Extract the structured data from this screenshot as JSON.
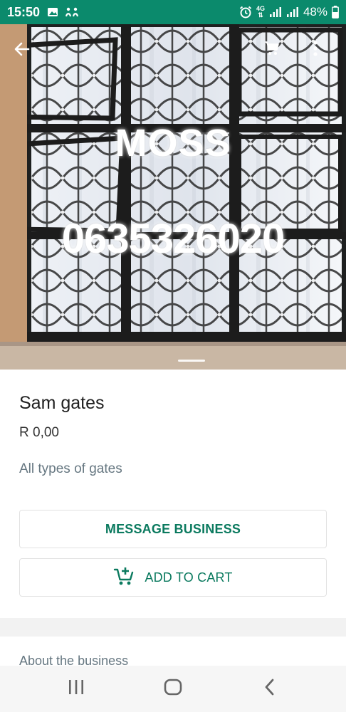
{
  "status_bar": {
    "time": "15:50",
    "left_icons": [
      "image-icon",
      "cast-icon"
    ],
    "right_icons": [
      "alarm-icon",
      "4g-icon",
      "signal-icon",
      "signal-icon",
      "battery-icon"
    ],
    "network": "4G",
    "battery": "48%",
    "color": "#0b8a6c"
  },
  "hero": {
    "watermark_line1": "MOSS",
    "watermark_line2": "0635326020"
  },
  "header_icons": {
    "back": "back-arrow-icon",
    "cart": "cart-icon",
    "more": "more-vert-icon"
  },
  "product": {
    "title": "Sam gates",
    "price": "R 0,00",
    "description": "All types of gates"
  },
  "actions": {
    "message_label": "MESSAGE BUSINESS",
    "add_to_cart_label": "ADD TO CART",
    "accent": "#0b7a5f"
  },
  "about": {
    "label": "About the business"
  },
  "nav": {
    "items": [
      "recents-icon",
      "home-icon",
      "back-icon"
    ]
  }
}
